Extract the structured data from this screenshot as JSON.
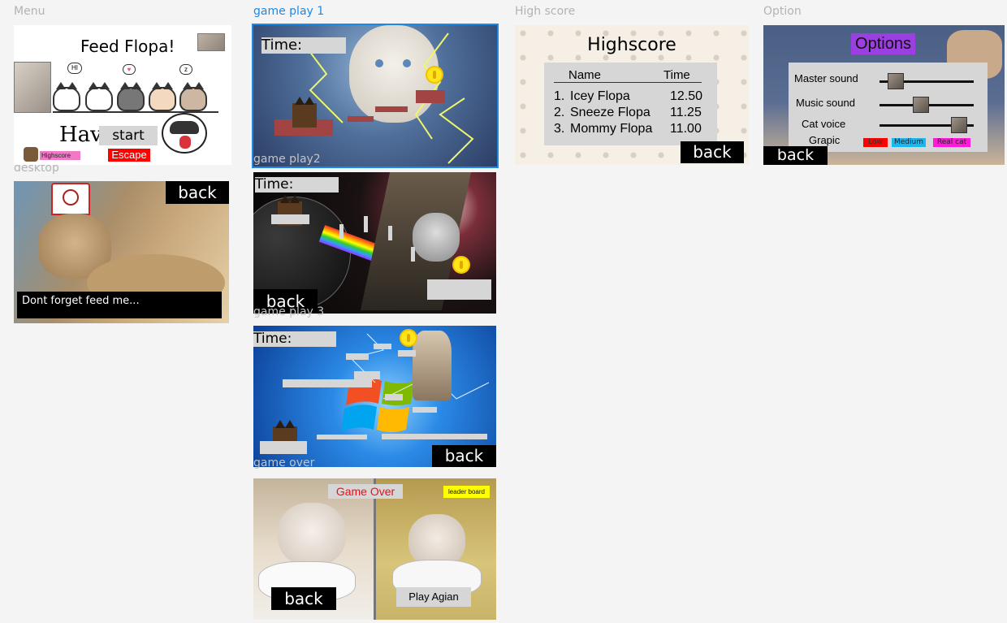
{
  "frames": {
    "menu": "Menu",
    "gameplay1": "game play 1",
    "gameplay2": "game play2",
    "gameplay3": "game play 3",
    "gameover": "game over",
    "highscore": "High score",
    "option": "Option",
    "desktop": "desktop"
  },
  "menu": {
    "title": "Feed Flopa!",
    "have_text": "Have",
    "start": "start",
    "escape": "Escape",
    "highscore": "Highscore",
    "bubble_hi": "HI",
    "bubble_heart": "♥",
    "bubble_z": "z"
  },
  "gameplay": {
    "time_label": "Time:",
    "back": "back"
  },
  "gameover": {
    "title": "Game Over",
    "leaderboard": "leader board",
    "back": "back",
    "play_again": "Play Agian"
  },
  "highscore": {
    "title": "Highscore",
    "col_name": "Name",
    "col_time": "Time",
    "rows": [
      {
        "rank": "1.",
        "name": "Icey Flopa",
        "time": "12.50"
      },
      {
        "rank": "2.",
        "name": "Sneeze Flopa",
        "time": "11.25"
      },
      {
        "rank": "3.",
        "name": "Mommy Flopa",
        "time": "11.00"
      }
    ],
    "back": "back"
  },
  "options": {
    "title": "Options",
    "master": "Master sound",
    "music": "Music sound",
    "voice": "Cat voice",
    "graphic": "Grapic",
    "low": "Low",
    "medium": "Medium",
    "real": "Real cat",
    "back": "back",
    "master_level": 0.1,
    "music_level": 0.43,
    "voice_level": 0.92
  },
  "desktop": {
    "back": "back",
    "caption": "Dont forget feed me..."
  },
  "colors": {
    "selection": "#1e88e5",
    "escape": "#ff0000",
    "highscore_tag": "#f07ac6",
    "options_title": "#9b3fe0",
    "leaderboard": "#ffff00",
    "gameover_text": "#e8101a"
  }
}
